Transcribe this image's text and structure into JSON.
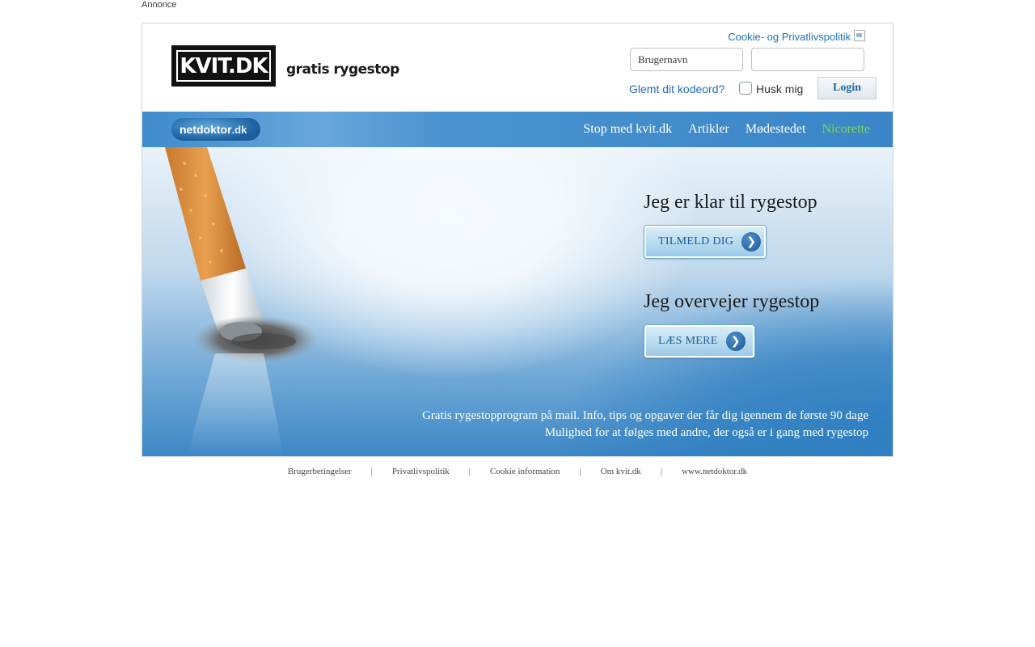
{
  "ad_label": "Annonce",
  "header": {
    "logo_text": "KVIT.DK",
    "tagline": "gratis rygestop",
    "cookie_link": "Cookie- og Privatlivspolitik",
    "username_placeholder": "Brugernavn",
    "password_value": "",
    "forgot_link": "Glemt dit kodeord?",
    "remember_label": "Husk mig",
    "remember_checked": false,
    "login_label": "Login"
  },
  "nav": {
    "logo_part1": "netdoktor",
    "logo_part2": ".dk",
    "items": [
      {
        "label": "Stop med kvit.dk"
      },
      {
        "label": "Artikler"
      },
      {
        "label": "Mødestedet"
      },
      {
        "label": "Nicorette"
      }
    ],
    "highlight_color": "#7ed957"
  },
  "hero": {
    "cta1_title": "Jeg er klar til rygestop",
    "cta1_button": "TILMELD DIG",
    "cta2_title": "Jeg overvejer rygestop",
    "cta2_button": "LÆS MERE",
    "desc_line1": "Gratis rygestopprogram på mail. Info, tips og opgaver der får dig igennem de første 90 dage",
    "desc_line2": "Mulighed for at følges med andre, der også er i gang med rygestop",
    "icons": {
      "cta_arrow": "chevron-right-icon"
    }
  },
  "footer": {
    "links": [
      "Brugerbetingelser",
      "Privatlivspolitik",
      "Cookie information",
      "Om kvit.dk",
      "www.netdoktor.dk"
    ],
    "separator": "|"
  },
  "colors": {
    "link_blue": "#1e6fb8",
    "nav_blue": "#3f8bcc"
  }
}
